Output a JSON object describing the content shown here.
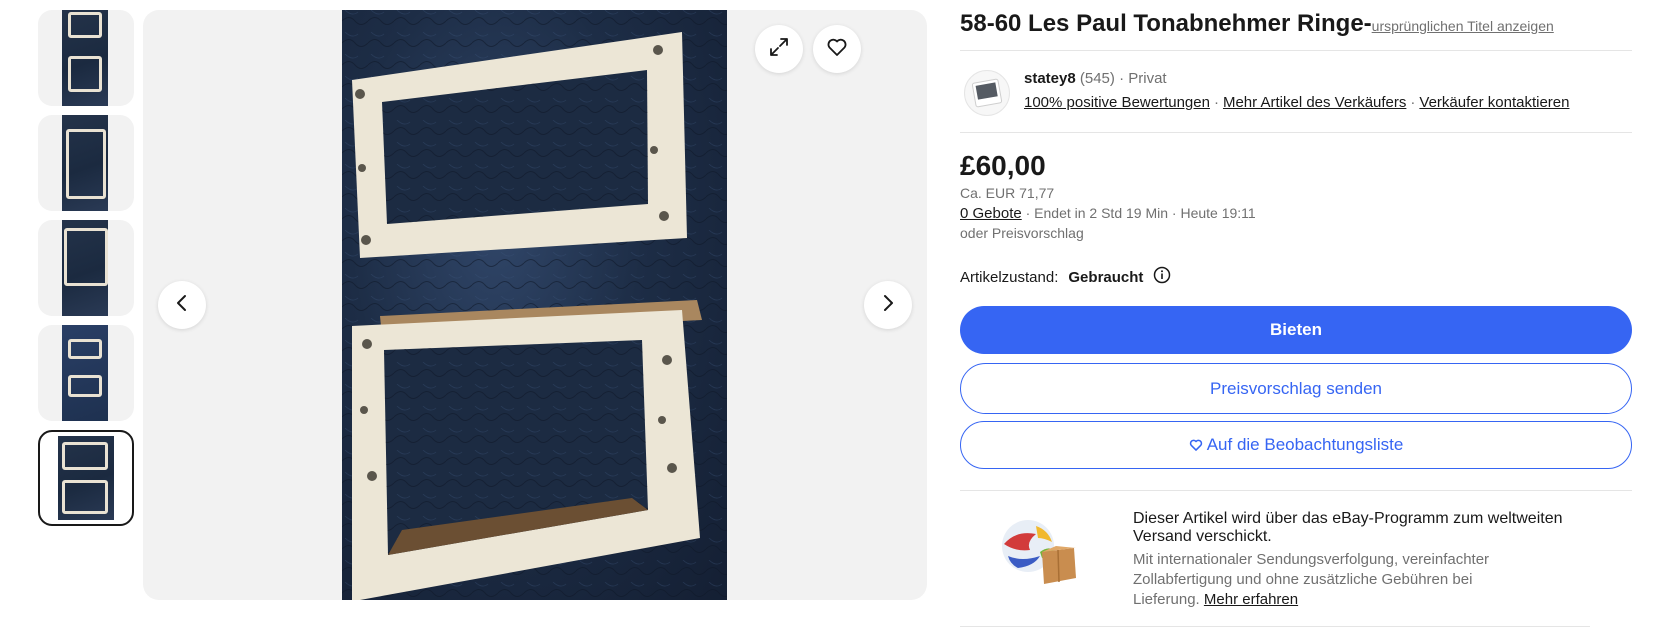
{
  "gallery": {
    "thumbnail_count": 5,
    "selected_thumbnail_index": 4,
    "icons": {
      "expand": "expand-icon",
      "watch": "heart-icon",
      "previous": "chevron-left-icon",
      "next": "chevron-right-icon"
    }
  },
  "item": {
    "title": "58-60 Les Paul Tonabnehmer Ringe-",
    "original_title_link": "ursprünglichen Titel anzeigen"
  },
  "seller": {
    "name": "statey8",
    "feedback_count": "(545)",
    "separator": "·",
    "type": "Privat",
    "positive_feedback": "100% positive Bewertungen",
    "more_items": "Mehr Artikel des Verkäufers",
    "contact": "Verkäufer kontaktieren"
  },
  "pricing": {
    "price": "£60,00",
    "approx": "Ca. EUR 71,77",
    "bids": "0 Gebote",
    "ends_in": " · Endet in 2 Std 19 Min · Heute 19:11",
    "or_offer": "oder Preisvorschlag"
  },
  "condition": {
    "label": "Artikelzustand:",
    "value": "Gebraucht"
  },
  "actions": {
    "bid": "Bieten",
    "make_offer": "Preisvorschlag senden",
    "watchlist": "Auf die Beobachtungsliste"
  },
  "shipping": {
    "title": "Dieser Artikel wird über das eBay-Programm zum weltweiten Versand verschickt.",
    "description": "Mit internationaler Sendungsverfolgung, vereinfachter Zollabfertigung und ohne zusätzliche Gebühren bei Lieferung. ",
    "learn_more": "Mehr erfahren"
  },
  "colors": {
    "primary": "#3665f3",
    "text": "#191919",
    "muted": "#707070",
    "gallery_bg": "#f2f2f2"
  }
}
